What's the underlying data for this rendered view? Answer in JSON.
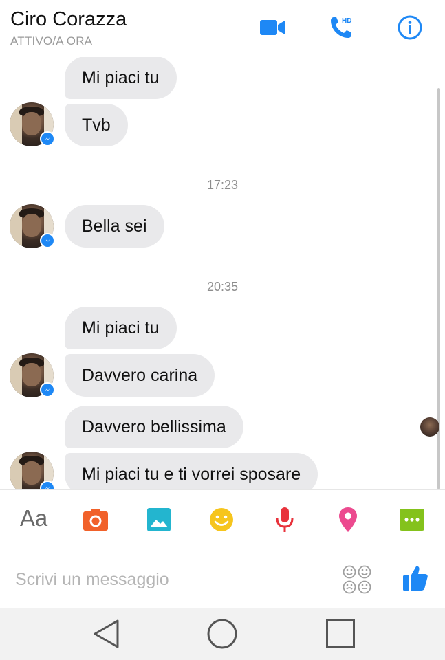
{
  "header": {
    "contact_name": "Ciro Corazza",
    "status": "ATTIVO/A ORA",
    "video_icon": "video-camera-icon",
    "call_icon": "phone-hd-icon",
    "call_badge": "HD",
    "info_icon": "info-icon"
  },
  "messages": [
    {
      "type": "bubble",
      "text": "Mi piaci tu"
    },
    {
      "type": "bubble",
      "text": "Tvb"
    },
    {
      "type": "timestamp",
      "text": "17:23"
    },
    {
      "type": "bubble",
      "text": "Bella sei"
    },
    {
      "type": "timestamp",
      "text": "20:35"
    },
    {
      "type": "bubble",
      "text": "Mi piaci tu"
    },
    {
      "type": "bubble",
      "text": "Davvero carina"
    },
    {
      "type": "bubble",
      "text": "Davvero bellissima"
    },
    {
      "type": "bubble",
      "text": "Mi piaci tu e ti vorrei sposare"
    }
  ],
  "toolbar": {
    "text_label": "Aa",
    "icons": [
      "text-format-icon",
      "camera-icon",
      "gallery-icon",
      "emoji-icon",
      "microphone-icon",
      "location-pin-icon",
      "more-icon"
    ]
  },
  "composer": {
    "placeholder": "Scrivi un messaggio",
    "value": ""
  },
  "colors": {
    "accent": "#1e88f5",
    "bubble_bg": "#e9e9eb",
    "camera": "#f1612a",
    "gallery": "#23b5cf",
    "emoji": "#f6c51d",
    "microphone": "#e8323b",
    "location": "#ec4a8f",
    "more": "#84c21c"
  },
  "navbar": {
    "icons": [
      "back-icon",
      "home-icon",
      "recents-icon"
    ]
  }
}
